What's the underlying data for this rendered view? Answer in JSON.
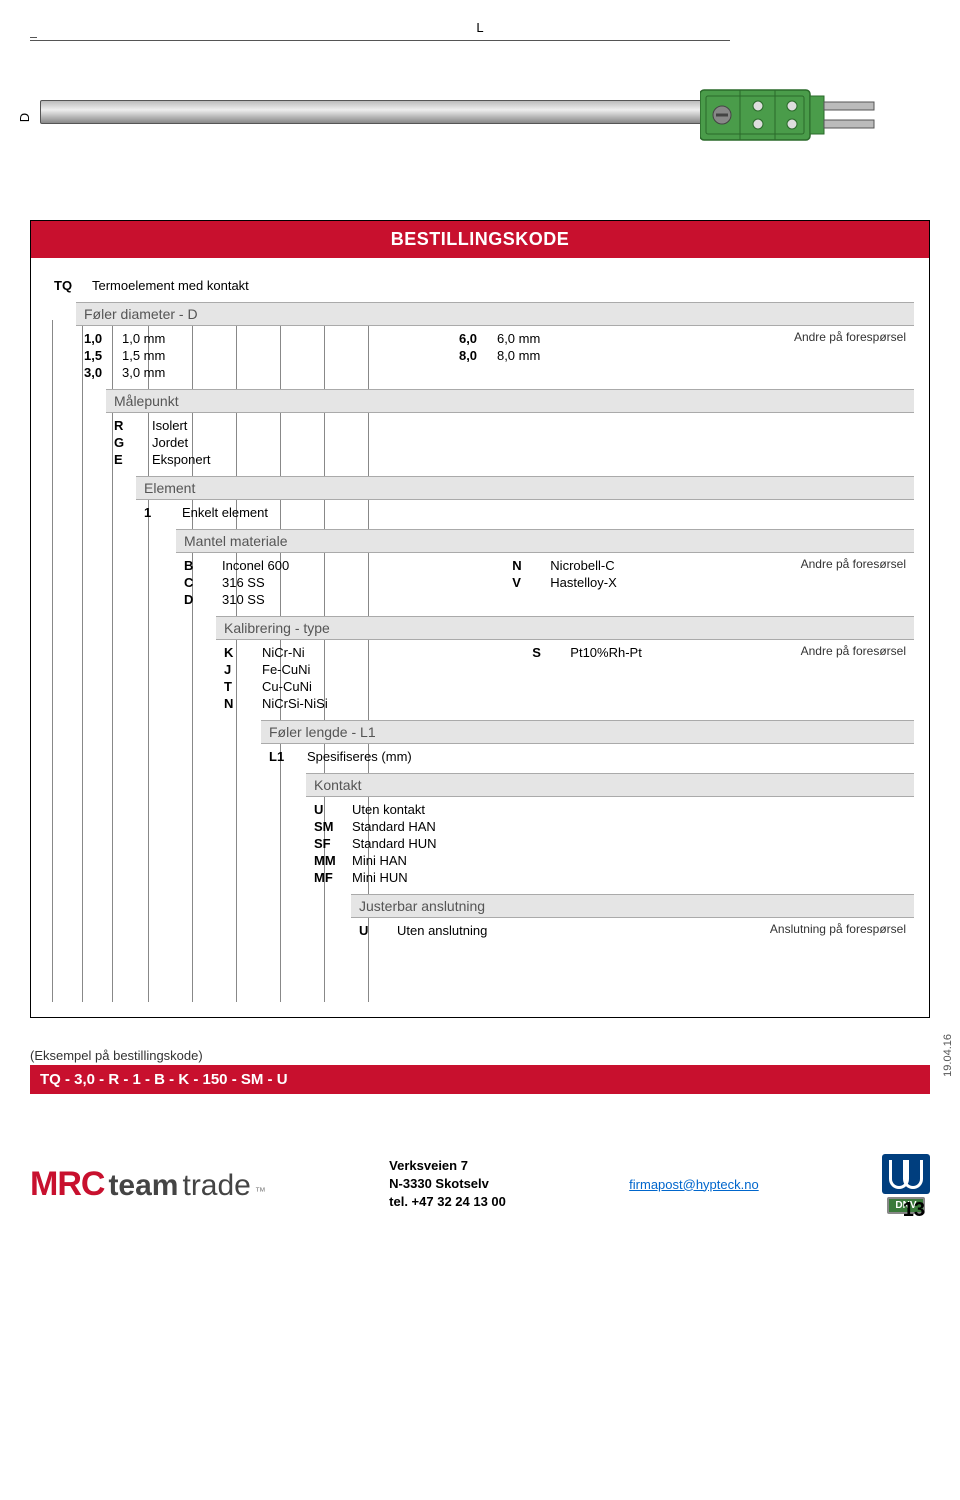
{
  "drawing": {
    "dimL": "L",
    "dimD": "D"
  },
  "title": "BESTILLINGSKODE",
  "tree": {
    "product": {
      "code": "TQ",
      "label": "Termoelement med kontakt"
    },
    "n1": {
      "header": "Føler diameter - D",
      "left": [
        {
          "k": "1,0",
          "v": "1,0 mm"
        },
        {
          "k": "1,5",
          "v": "1,5 mm"
        },
        {
          "k": "3,0",
          "v": "3,0 mm"
        }
      ],
      "right": [
        {
          "k": "6,0",
          "v": "6,0 mm"
        },
        {
          "k": "8,0",
          "v": "8,0 mm"
        }
      ],
      "note": "Andre på forespørsel"
    },
    "n2": {
      "header": "Målepunkt",
      "items": [
        {
          "k": "R",
          "v": "Isolert"
        },
        {
          "k": "G",
          "v": "Jordet"
        },
        {
          "k": "E",
          "v": "Eksponert"
        }
      ]
    },
    "n3": {
      "header": "Element",
      "items": [
        {
          "k": "1",
          "v": "Enkelt element"
        }
      ]
    },
    "n4": {
      "header": "Mantel materiale",
      "left": [
        {
          "k": "B",
          "v": "Inconel 600"
        },
        {
          "k": "C",
          "v": "316 SS"
        },
        {
          "k": "D",
          "v": "310 SS"
        }
      ],
      "right": [
        {
          "k": "N",
          "v": "Nicrobell-C"
        },
        {
          "k": "V",
          "v": "Hastelloy-X"
        }
      ],
      "note": "Andre på foresørsel"
    },
    "n5": {
      "header": "Kalibrering - type",
      "left": [
        {
          "k": "K",
          "v": "NiCr-Ni"
        },
        {
          "k": "J",
          "v": "Fe-CuNi"
        },
        {
          "k": "T",
          "v": "Cu-CuNi"
        },
        {
          "k": "N",
          "v": "NiCrSi-NiSi"
        }
      ],
      "right": [
        {
          "k": "S",
          "v": "Pt10%Rh-Pt"
        }
      ],
      "note": "Andre på foresørsel"
    },
    "n6": {
      "header": "Føler lengde - L1",
      "items": [
        {
          "k": "L1",
          "v": "Spesifiseres (mm)"
        }
      ]
    },
    "n7": {
      "header": "Kontakt",
      "items": [
        {
          "k": "U",
          "v": "Uten kontakt"
        },
        {
          "k": "SM",
          "v": "Standard HAN"
        },
        {
          "k": "SF",
          "v": "Standard HUN"
        },
        {
          "k": "MM",
          "v": "Mini HAN"
        },
        {
          "k": "MF",
          "v": "Mini HUN"
        }
      ]
    },
    "n8": {
      "header": "Justerbar anslutning",
      "items": [
        {
          "k": "U",
          "v": "Uten anslutning"
        }
      ],
      "note": "Anslutning på forespørsel"
    }
  },
  "example": {
    "label": "(Eksempel på bestillingskode)",
    "code": "TQ  -  3,0  -  R  -  1  -  B  -  K  -  150  -  SM  -  U"
  },
  "footer": {
    "logo": {
      "mrc": "MRC",
      "team": "team",
      "trade": "trade",
      "tm": "™"
    },
    "addr1": "Verksveien 7",
    "addr2": "N-3330 Skotselv",
    "addr3": "tel. +47 32 24 13 00",
    "email": "firmapost@hypteck.no",
    "dnv": "DNV",
    "page": "13",
    "date": "19.04.16"
  }
}
